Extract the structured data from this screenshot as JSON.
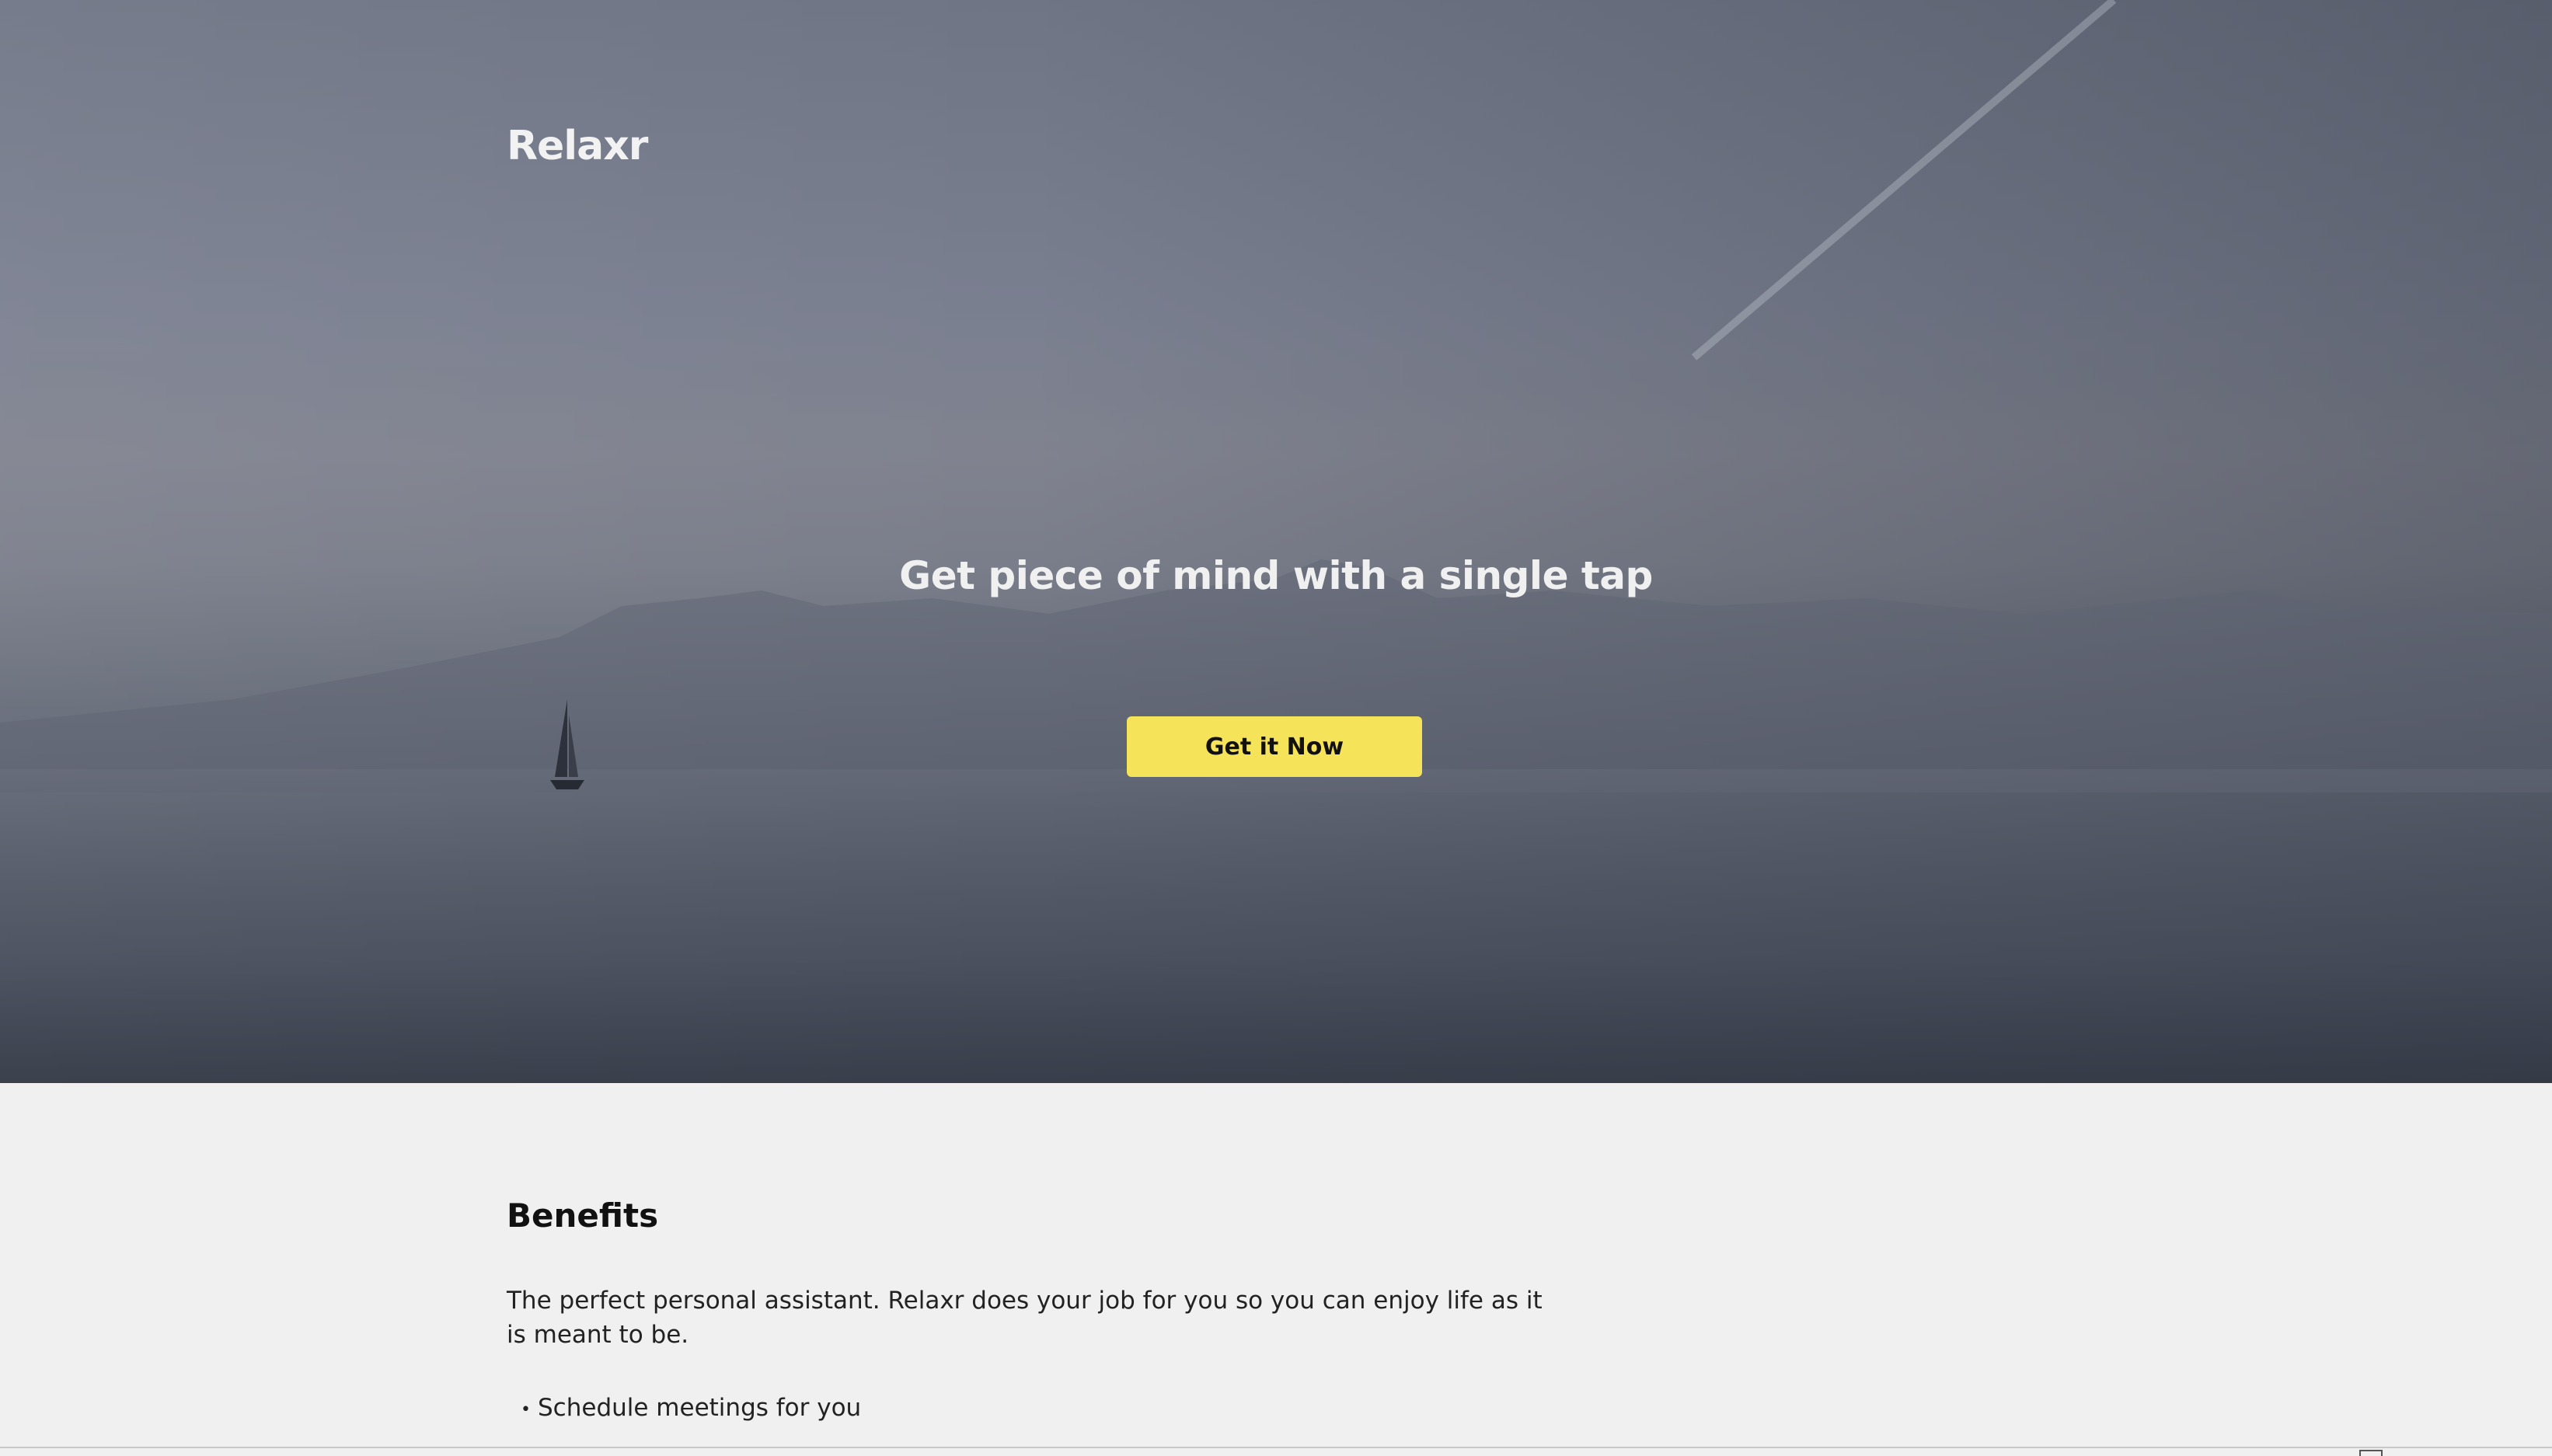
{
  "brand": {
    "name": "Relaxr"
  },
  "hero": {
    "headline": "Get piece of mind with a single tap",
    "cta_label": "Get it Now",
    "cta_color": "#f5e35a"
  },
  "benefits": {
    "heading": "Benefits",
    "description": "The perfect personal assistant. Relaxr does your job for you so you can enjoy life as it is meant to be.",
    "items": [
      "Schedule meetings for you"
    ]
  }
}
